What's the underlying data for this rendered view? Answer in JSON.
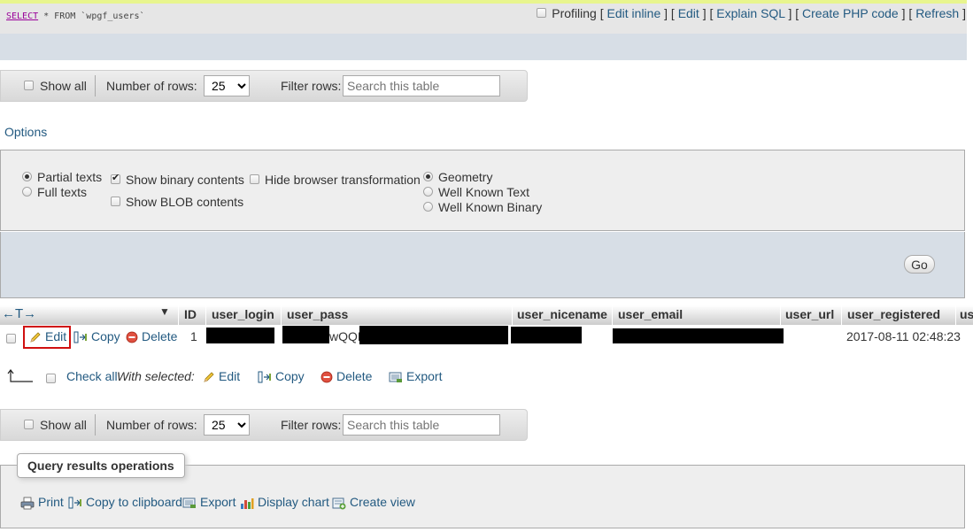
{
  "sql": {
    "keyword": "SELECT",
    "rest": " * FROM `wpgf_users`"
  },
  "sql_links": {
    "profiling": "Profiling",
    "edit_inline": "Edit inline",
    "edit": "Edit",
    "explain": "Explain SQL",
    "create_php": "Create PHP code",
    "refresh": "Refresh"
  },
  "nav": {
    "show_all": "Show all",
    "rows_label": "Number of rows:",
    "rows_value": "25",
    "filter_label": "Filter rows:",
    "filter_placeholder": "Search this table"
  },
  "options": {
    "link": "Options",
    "partial": "Partial texts",
    "full": "Full texts",
    "show_binary": "Show binary contents",
    "show_blob": "Show BLOB contents",
    "hide_browser": "Hide browser transformation",
    "geometry": "Geometry",
    "wkt": "Well Known Text",
    "wkb": "Well Known Binary",
    "go": "Go"
  },
  "table": {
    "arrows": "←T→",
    "columns": [
      "ID",
      "user_login",
      "user_pass",
      "user_nicename",
      "user_email",
      "user_url",
      "user_registered",
      "us"
    ],
    "row": {
      "edit": "Edit",
      "copy": "Copy",
      "delete": "Delete",
      "id": "1",
      "pass_visible": "wQQE",
      "registered": "2017-08-11 02:48:23"
    }
  },
  "bulk": {
    "check_all": "Check all",
    "with_selected": "With selected:",
    "edit": "Edit",
    "copy": "Copy",
    "delete": "Delete",
    "export": "Export"
  },
  "query_ops": {
    "legend": "Query results operations",
    "print": "Print",
    "copy_clipboard": "Copy to clipboard",
    "export": "Export",
    "display_chart": "Display chart",
    "create_view": "Create view"
  },
  "colors": {
    "link": "#235a81",
    "highlight": "#d01010",
    "accent_top": "#e8f58e"
  }
}
